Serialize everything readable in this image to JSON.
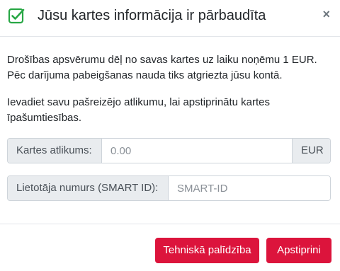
{
  "header": {
    "title": "Jūsu kartes informācija ir pārbaudīta",
    "check_icon": "check-square-icon",
    "close_icon": "close-icon",
    "close_glyph": "×",
    "accent_color": "#28a745"
  },
  "body": {
    "paragraph1_line1": "Drošības apsvērumu dēļ no savas kartes uz laiku noņēmu 1 EUR.",
    "paragraph1_line2": "Pēc darījuma pabeigšanas nauda tiks atgriezta jūsu kontā.",
    "paragraph2_line1": "Ievadiet savu pašreizējo atlikumu, lai apstiprinātu kartes",
    "paragraph2_line2": "īpašumtiesības."
  },
  "form": {
    "balance": {
      "label": "Kartes atlikums:",
      "placeholder": "0.00",
      "value": "",
      "suffix": "EUR"
    },
    "smart_id": {
      "label": "Lietotāja numurs (SMART ID):",
      "placeholder": "SMART-ID",
      "value": ""
    }
  },
  "footer": {
    "help_label": "Tehniskā palīdzība",
    "confirm_label": "Apstiprini",
    "button_color": "#dc143c"
  }
}
